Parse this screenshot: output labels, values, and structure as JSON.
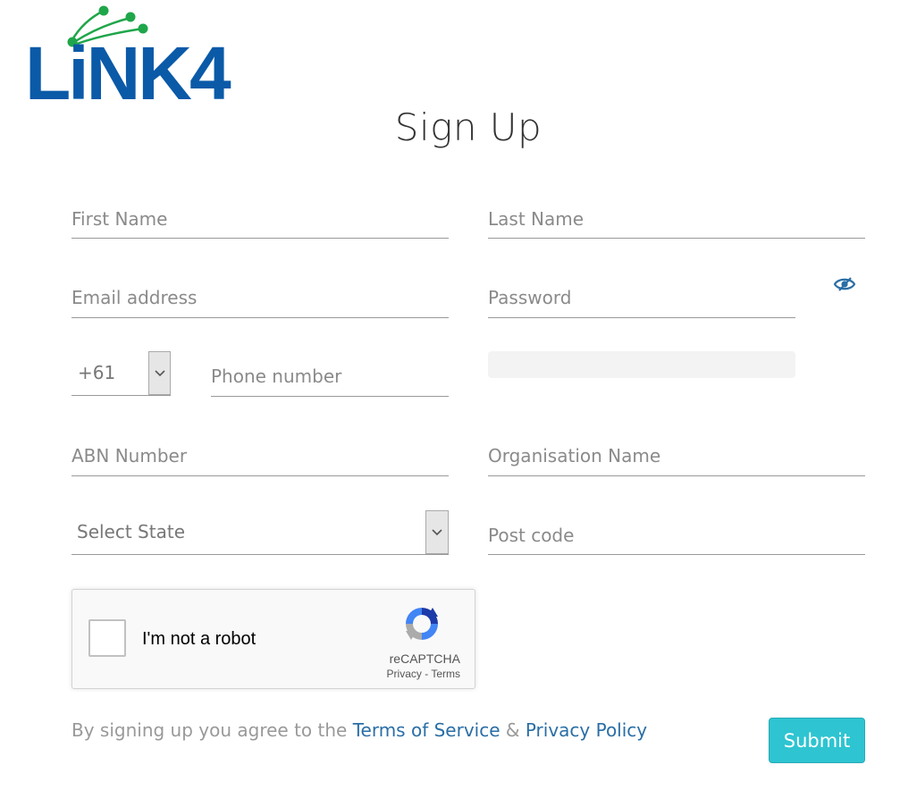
{
  "brand": {
    "logo_text": "LiNK4",
    "primary_color": "#0a5aa8",
    "node_color": "#1fa64a"
  },
  "page": {
    "title": "Sign Up"
  },
  "form": {
    "first_name": {
      "placeholder": "First Name",
      "value": ""
    },
    "last_name": {
      "placeholder": "Last Name",
      "value": ""
    },
    "email": {
      "placeholder": "Email address",
      "value": ""
    },
    "password": {
      "placeholder": "Password",
      "value": "",
      "toggle_icon": "eye-icon"
    },
    "country_code": {
      "selected": "+61"
    },
    "phone": {
      "placeholder": "Phone number",
      "value": ""
    },
    "abn": {
      "placeholder": "ABN Number",
      "value": ""
    },
    "organisation": {
      "placeholder": "Organisation Name",
      "value": ""
    },
    "state": {
      "selected": "Select State"
    },
    "postcode": {
      "placeholder": "Post code",
      "value": ""
    }
  },
  "recaptcha": {
    "label": "I'm not a robot",
    "brand": "reCAPTCHA",
    "privacy": "Privacy",
    "separator": " - ",
    "terms": "Terms"
  },
  "footer": {
    "agree_text": "By signing up you agree to the ",
    "terms_link": "Terms of Service",
    "ampersand": " & ",
    "privacy_link": "Privacy Policy"
  },
  "submit": {
    "label": "Submit",
    "color": "#2ec4d1"
  }
}
